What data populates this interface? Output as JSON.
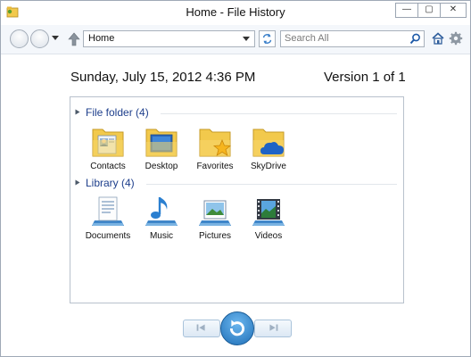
{
  "window": {
    "title": "Home - File History",
    "controls": {
      "minimize": "—",
      "maximize": "▢",
      "close": "✕"
    }
  },
  "navbar": {
    "address": "Home",
    "search_placeholder": "Search All"
  },
  "header": {
    "date": "Sunday, July 15, 2012 4:36 PM",
    "version": "Version 1 of 1"
  },
  "groups": [
    {
      "label": "File folder (4)",
      "items": [
        {
          "label": "Contacts",
          "icon": "contacts-folder-icon"
        },
        {
          "label": "Desktop",
          "icon": "desktop-folder-icon"
        },
        {
          "label": "Favorites",
          "icon": "favorites-folder-icon"
        },
        {
          "label": "SkyDrive",
          "icon": "skydrive-folder-icon"
        }
      ]
    },
    {
      "label": "Library (4)",
      "items": [
        {
          "label": "Documents",
          "icon": "documents-library-icon"
        },
        {
          "label": "Music",
          "icon": "music-library-icon"
        },
        {
          "label": "Pictures",
          "icon": "pictures-library-icon"
        },
        {
          "label": "Videos",
          "icon": "videos-library-icon"
        }
      ]
    }
  ],
  "colors": {
    "group_header": "#1e3f8c",
    "folder": "#f2c94c",
    "accent": "#1f6fb7"
  }
}
